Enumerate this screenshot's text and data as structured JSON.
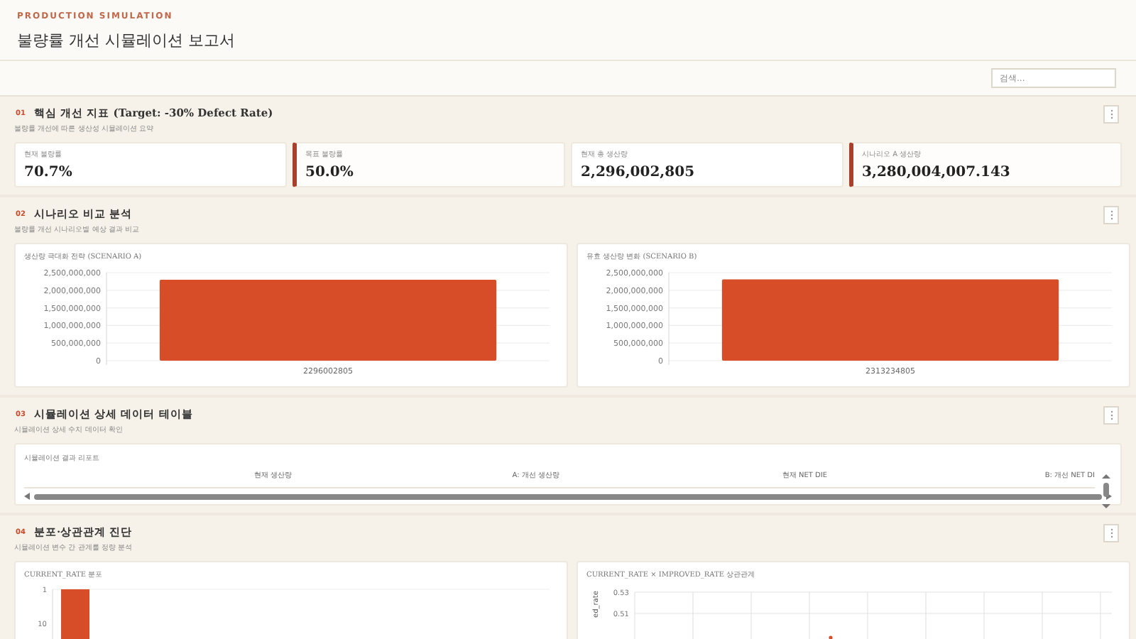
{
  "header": {
    "eyebrow": "PRODUCTION SIMULATION",
    "title": "불량률 개선 시뮬레이션 보고서"
  },
  "search": {
    "placeholder": "검색..."
  },
  "sections": [
    {
      "kind": "metrics",
      "number": "01",
      "title": "핵심 개선 지표 (Target: -30% Defect Rate)",
      "subtitle": "불량률 개선에 따른 생산성 시뮬레이션 요약",
      "metrics": [
        {
          "label": "현재 불량률",
          "value": "70.7%",
          "highlighted": false
        },
        {
          "label": "목표 불량률",
          "value": "50.0%",
          "highlighted": true
        },
        {
          "label": "현재 총 생산량",
          "value": "2,296,002,805",
          "highlighted": false
        },
        {
          "label": "시나리오 A 생산량",
          "value": "3,280,004,007.143",
          "highlighted": true
        }
      ]
    },
    {
      "kind": "charts",
      "number": "02",
      "title": "시나리오 비교 분석",
      "subtitle": "불량률 개선 시나리오별 예상 결과 비교",
      "charts": [
        {
          "title": "생산량 극대화 전략 (SCENARIO A)",
          "chart_data": {
            "type": "bar",
            "categories": [
              "2296002805"
            ],
            "values": [
              2300000000
            ],
            "grid": true,
            "ylim": [
              0,
              2500000000
            ],
            "yticks": [
              {
                "value": 0,
                "label": "0"
              },
              {
                "value": 500000000,
                "label": "500,000,000"
              },
              {
                "value": 1000000000,
                "label": "1,000,000,000"
              },
              {
                "value": 1500000000,
                "label": "1,500,000,000"
              },
              {
                "value": 2000000000,
                "label": "2,000,000,000"
              },
              {
                "value": 2500000000,
                "label": "2,500,000,000"
              }
            ]
          }
        },
        {
          "title": "유효 생산량 변화 (SCENARIO B)",
          "chart_data": {
            "type": "bar",
            "categories": [
              "2313234805"
            ],
            "values": [
              2310000000
            ],
            "grid": true,
            "ylim": [
              0,
              2500000000
            ],
            "yticks": [
              {
                "value": 0,
                "label": "0"
              },
              {
                "value": 500000000,
                "label": "500,000,000"
              },
              {
                "value": 1000000000,
                "label": "1,000,000,000"
              },
              {
                "value": 1500000000,
                "label": "1,500,000,000"
              },
              {
                "value": 2000000000,
                "label": "2,000,000,000"
              },
              {
                "value": 2500000000,
                "label": "2,500,000,000"
              }
            ]
          }
        }
      ]
    },
    {
      "kind": "table",
      "number": "03",
      "title": "시뮬레이션 상세 데이터 테이블",
      "subtitle": "시뮬레이션 상세 수치 데이터 확인",
      "table": {
        "caption": "시뮬레이션 결과 리포트",
        "columns": [
          "현재 생산량",
          "A: 개선 생산량",
          "현재 NET DIE",
          "B: 개선 NET DI"
        ]
      }
    },
    {
      "kind": "diagnostics",
      "number": "04",
      "title": "분포·상관관계 진단",
      "subtitle": "시뮬레이션 변수 간 관계를 정량 분석",
      "panels": [
        {
          "kind": "histogram",
          "title": "CURRENT_RATE 분포",
          "tick_labels": [
            "1",
            "10"
          ]
        },
        {
          "kind": "scatter",
          "title": "CURRENT_RATE × IMPROVED_RATE 상관관계",
          "tick_labels": [
            "0.53",
            "0.51"
          ],
          "ylabel": "ed_rate"
        }
      ]
    }
  ]
}
